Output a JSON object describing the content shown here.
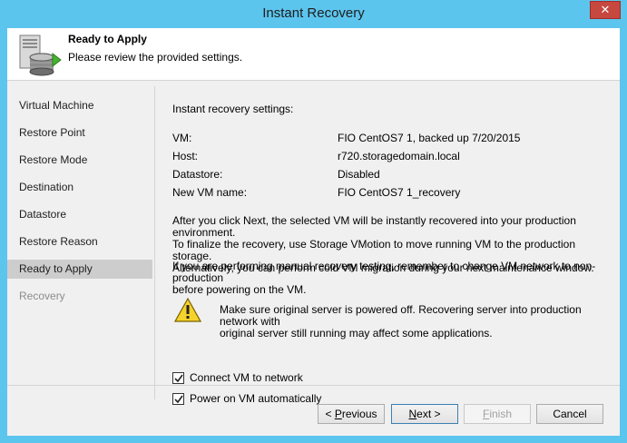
{
  "window": {
    "title": "Instant Recovery",
    "close_glyph": "✕"
  },
  "header": {
    "title": "Ready to Apply",
    "subtitle": "Please review the provided  settings.",
    "icon": "server-database-arrow-icon"
  },
  "nav": {
    "items": [
      {
        "label": "Virtual Machine",
        "state": "normal"
      },
      {
        "label": "Restore Point",
        "state": "normal"
      },
      {
        "label": "Restore Mode",
        "state": "normal"
      },
      {
        "label": "Destination",
        "state": "normal"
      },
      {
        "label": "Datastore",
        "state": "normal"
      },
      {
        "label": "Restore Reason",
        "state": "normal"
      },
      {
        "label": "Ready to Apply",
        "state": "selected"
      },
      {
        "label": "Recovery",
        "state": "disabled"
      }
    ]
  },
  "summary": {
    "heading": "Instant recovery settings:",
    "rows": [
      {
        "label": "VM:",
        "value": "FIO CentOS7 1, backed up 7/20/2015"
      },
      {
        "label": "Host:",
        "value": "r720.storagedomain.local"
      },
      {
        "label": "Datastore:",
        "value": "Disabled"
      },
      {
        "label": "New VM name:",
        "value": "FIO CentOS7 1_recovery"
      }
    ],
    "info_lines": [
      "After you click Next, the selected VM will be instantly recovered into your production environment.",
      "To finalize the recovery, use Storage VMotion to move running VM to the production storage.",
      "Alternatively, you can perform cold VM migration during your next maintenance window."
    ],
    "testing_lines": [
      "If you are performing manual recovery testing, remember to change VM network to non-production",
      "before powering on the VM."
    ],
    "warning_lines": [
      "Make sure original server is powered off. Recovering server into production network with",
      "original server still running may affect some applications."
    ]
  },
  "options": {
    "connect_network": {
      "label": "Connect VM to network",
      "checked": true
    },
    "power_on": {
      "label": "Power on VM automatically",
      "checked": true
    }
  },
  "buttons": {
    "previous": {
      "prefix": "< ",
      "accel": "P",
      "rest": "revious"
    },
    "next": {
      "accel": "N",
      "rest": "ext >"
    },
    "finish": {
      "accel": "F",
      "rest": "inish"
    },
    "cancel": {
      "label": "Cancel"
    }
  },
  "colors": {
    "titlebar": "#5cc5ee",
    "close_button": "#c7483f",
    "selected_nav": "#cdcdcd",
    "warning": "#f5d32b"
  }
}
